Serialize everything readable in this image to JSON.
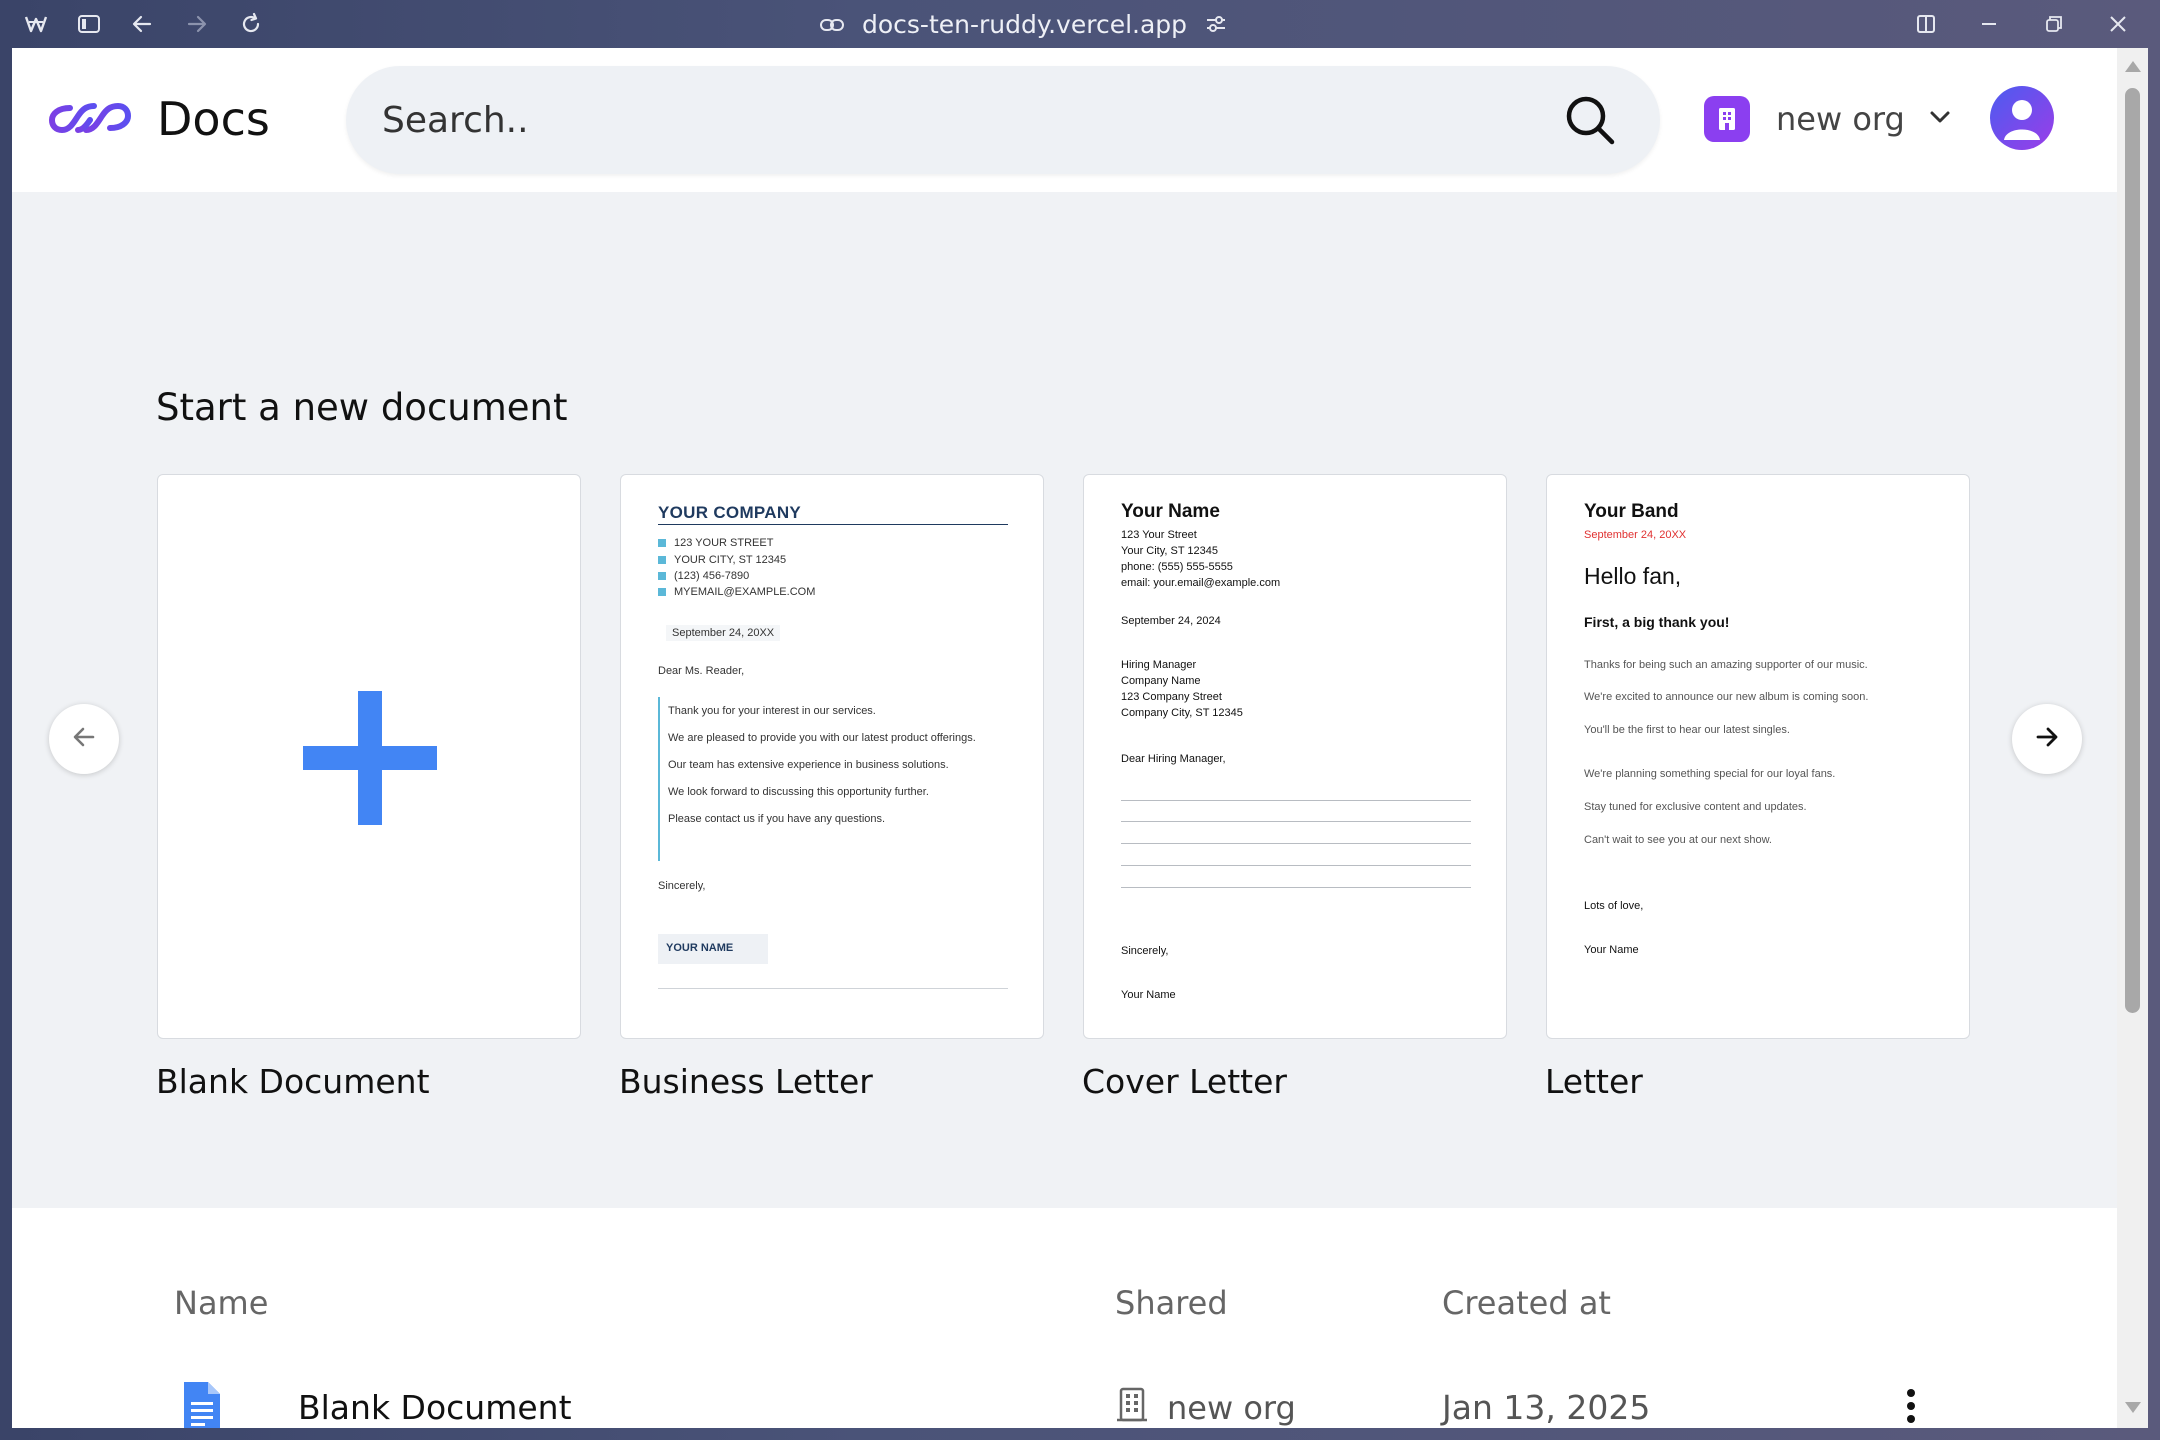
{
  "browser": {
    "url": "docs-ten-ruddy.vercel.app"
  },
  "header": {
    "app_title": "Docs",
    "search_placeholder": "Search..",
    "org_name": "new org"
  },
  "templates": {
    "section_title": "Start a new document",
    "cards": [
      {
        "label": "Blank Document"
      },
      {
        "label": "Business Letter",
        "company": "YOUR COMPANY",
        "address_lines": [
          "123 YOUR STREET",
          "YOUR CITY, ST 12345",
          "(123) 456-7890",
          "MYEMAIL@EXAMPLE.COM"
        ],
        "date": "September 24, 20XX",
        "salutation": "Dear Ms. Reader,",
        "body": [
          "Thank you for your interest in our services.",
          "We are pleased to provide you with our latest product offerings.",
          "Our team has extensive experience in business solutions.",
          "We look forward to discussing this opportunity further.",
          "Please contact us if you have any questions."
        ],
        "closing": "Sincerely,",
        "signature": "YOUR NAME"
      },
      {
        "label": "Cover Letter",
        "name": "Your Name",
        "contact_lines": [
          "123 Your Street",
          "Your City, ST 12345",
          "phone: (555) 555-5555",
          "email: your.email@example.com"
        ],
        "date": "September 24, 2024",
        "recipient_lines": [
          "Hiring Manager",
          "Company Name",
          "123 Company Street",
          "Company City, ST 12345"
        ],
        "salutation": "Dear Hiring Manager,",
        "closing": "Sincerely,",
        "signature": "Your Name"
      },
      {
        "label": "Letter",
        "band": "Your Band",
        "date": "September 24, 20XX",
        "greeting": "Hello fan,",
        "subheading": "First, a big thank you!",
        "body": [
          "Thanks for being such an amazing supporter of our music.",
          "We're excited to announce our new album is coming soon.",
          "You'll be the first to hear our latest singles.",
          "We're planning something special for our loyal fans.",
          "Stay tuned for exclusive content and updates.",
          "Can't wait to see you at our next show."
        ],
        "closing": "Lots of love,",
        "signature": "Your Name"
      }
    ]
  },
  "documents": {
    "columns": {
      "name": "Name",
      "shared": "Shared",
      "created": "Created at"
    },
    "rows": [
      {
        "name": "Blank Document",
        "shared": "new org",
        "created": "Jan 13, 2025"
      }
    ]
  },
  "colors": {
    "accent": "#8b3ff0",
    "plus": "#4285f4",
    "doc_icon": "#4285f4",
    "band_date": "#e03131"
  }
}
